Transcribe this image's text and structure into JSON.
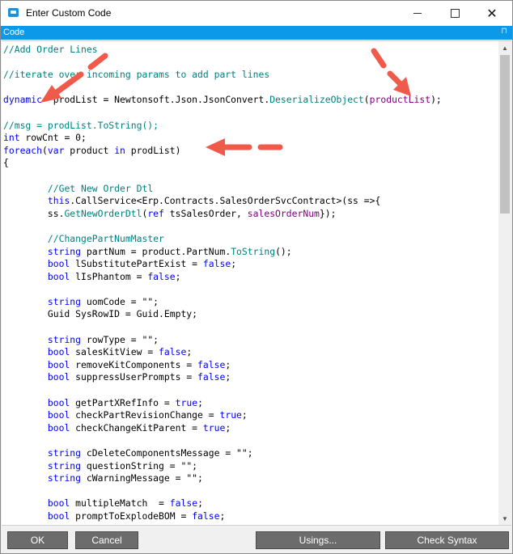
{
  "window": {
    "title": "Enter Custom Code",
    "controls": {
      "minimize": "—",
      "maximize": "☐",
      "close": "✕"
    }
  },
  "panel": {
    "label": "Code",
    "pin_symbol": "⊓"
  },
  "code_lines": [
    [
      [
        "cm",
        "//Add Order Lines"
      ]
    ],
    [],
    [
      [
        "cm",
        "//iterate over incoming params to add part lines"
      ]
    ],
    [],
    [
      [
        "kw",
        "dynamic"
      ],
      [
        "",
        "  prodList = Newtonsoft.Json.JsonConvert."
      ],
      [
        "mt",
        "DeserializeObject"
      ],
      [
        "",
        "("
      ],
      [
        "pr",
        "productList"
      ],
      [
        "",
        ");"
      ]
    ],
    [],
    [
      [
        "cm",
        "//msg = prodList.ToString();"
      ]
    ],
    [
      [
        "kw",
        "int"
      ],
      [
        "",
        " rowCnt = 0;"
      ]
    ],
    [
      [
        "kw",
        "foreach"
      ],
      [
        "",
        "("
      ],
      [
        "kw",
        "var"
      ],
      [
        "",
        " product "
      ],
      [
        "kw",
        "in"
      ],
      [
        "",
        " prodList)"
      ]
    ],
    [
      [
        "",
        "{"
      ]
    ],
    [],
    [
      [
        "",
        "        "
      ],
      [
        "cm",
        "//Get New Order Dtl"
      ]
    ],
    [
      [
        "",
        "        "
      ],
      [
        "kw",
        "this"
      ],
      [
        "",
        ".CallService<Erp.Contracts.SalesOrderSvcContract>(ss =>{"
      ]
    ],
    [
      [
        "",
        "        ss."
      ],
      [
        "mt",
        "GetNewOrderDtl"
      ],
      [
        "",
        "("
      ],
      [
        "kw",
        "ref"
      ],
      [
        "",
        " tsSalesOrder, "
      ],
      [
        "pr",
        "salesOrderNum"
      ],
      [
        "",
        "});"
      ]
    ],
    [],
    [
      [
        "",
        "        "
      ],
      [
        "cm",
        "//ChangePartNumMaster"
      ]
    ],
    [
      [
        "",
        "        "
      ],
      [
        "kw",
        "string"
      ],
      [
        "",
        " partNum = product.PartNum."
      ],
      [
        "mt",
        "ToString"
      ],
      [
        "",
        "();"
      ]
    ],
    [
      [
        "",
        "        "
      ],
      [
        "kw",
        "bool"
      ],
      [
        "",
        " lSubstitutePartExist = "
      ],
      [
        "kw",
        "false"
      ],
      [
        "",
        ";"
      ]
    ],
    [
      [
        "",
        "        "
      ],
      [
        "kw",
        "bool"
      ],
      [
        "",
        " lIsPhantom = "
      ],
      [
        "kw",
        "false"
      ],
      [
        "",
        ";"
      ]
    ],
    [],
    [
      [
        "",
        "        "
      ],
      [
        "kw",
        "string"
      ],
      [
        "",
        " uomCode = \"\";"
      ]
    ],
    [
      [
        "",
        "        Guid SysRowID = Guid.Empty;"
      ]
    ],
    [],
    [
      [
        "",
        "        "
      ],
      [
        "kw",
        "string"
      ],
      [
        "",
        " rowType = \"\";"
      ]
    ],
    [
      [
        "",
        "        "
      ],
      [
        "kw",
        "bool"
      ],
      [
        "",
        " salesKitView = "
      ],
      [
        "kw",
        "false"
      ],
      [
        "",
        ";"
      ]
    ],
    [
      [
        "",
        "        "
      ],
      [
        "kw",
        "bool"
      ],
      [
        "",
        " removeKitComponents = "
      ],
      [
        "kw",
        "false"
      ],
      [
        "",
        ";"
      ]
    ],
    [
      [
        "",
        "        "
      ],
      [
        "kw",
        "bool"
      ],
      [
        "",
        " suppressUserPrompts = "
      ],
      [
        "kw",
        "false"
      ],
      [
        "",
        ";"
      ]
    ],
    [],
    [
      [
        "",
        "        "
      ],
      [
        "kw",
        "bool"
      ],
      [
        "",
        " getPartXRefInfo = "
      ],
      [
        "kw",
        "true"
      ],
      [
        "",
        ";"
      ]
    ],
    [
      [
        "",
        "        "
      ],
      [
        "kw",
        "bool"
      ],
      [
        "",
        " checkPartRevisionChange = "
      ],
      [
        "kw",
        "true"
      ],
      [
        "",
        ";"
      ]
    ],
    [
      [
        "",
        "        "
      ],
      [
        "kw",
        "bool"
      ],
      [
        "",
        " checkChangeKitParent = "
      ],
      [
        "kw",
        "true"
      ],
      [
        "",
        ";"
      ]
    ],
    [],
    [
      [
        "",
        "        "
      ],
      [
        "kw",
        "string"
      ],
      [
        "",
        " cDeleteComponentsMessage = \"\";"
      ]
    ],
    [
      [
        "",
        "        "
      ],
      [
        "kw",
        "string"
      ],
      [
        "",
        " questionString = \"\";"
      ]
    ],
    [
      [
        "",
        "        "
      ],
      [
        "kw",
        "string"
      ],
      [
        "",
        " cWarningMessage = \"\";"
      ]
    ],
    [],
    [
      [
        "",
        "        "
      ],
      [
        "kw",
        "bool"
      ],
      [
        "",
        " multipleMatch  = "
      ],
      [
        "kw",
        "false"
      ],
      [
        "",
        ";"
      ]
    ],
    [
      [
        "",
        "        "
      ],
      [
        "kw",
        "bool"
      ],
      [
        "",
        " promptToExplodeBOM = "
      ],
      [
        "kw",
        "false"
      ],
      [
        "",
        ";"
      ]
    ]
  ],
  "scrollbar": {
    "up": "▲",
    "down": "▼"
  },
  "buttons": {
    "ok": "OK",
    "cancel": "Cancel",
    "usings": "Usings...",
    "check_syntax": "Check Syntax"
  },
  "colors": {
    "keyword": "#0000ff",
    "comment": "#008080",
    "method": "#008080",
    "param": "#800080",
    "accent": "#0d99ea",
    "annotation_arrow": "#f05a4a"
  }
}
